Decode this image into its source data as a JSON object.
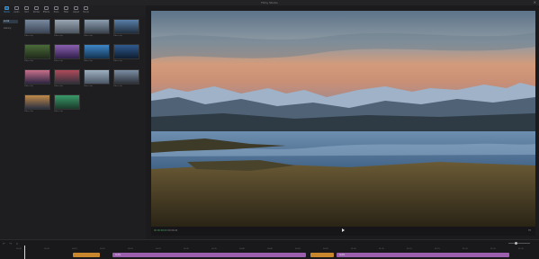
{
  "window": {
    "title": "Filmy Studio",
    "close": "✕"
  },
  "toolbar": {
    "tools": [
      {
        "label": "Media",
        "icon": "media-icon"
      },
      {
        "label": "Audio",
        "icon": "audio-icon"
      },
      {
        "label": "Text",
        "icon": "text-icon"
      },
      {
        "label": "Sticker",
        "icon": "sticker-icon"
      },
      {
        "label": "Effects",
        "icon": "effects-icon"
      },
      {
        "label": "Trans",
        "icon": "transitions-icon"
      },
      {
        "label": "Filter",
        "icon": "filter-icon"
      },
      {
        "label": "Adjust",
        "icon": "adjust-icon"
      },
      {
        "label": "Templ",
        "icon": "templates-icon"
      }
    ]
  },
  "sidebar": {
    "items": [
      {
        "label": "Local"
      },
      {
        "label": "Library"
      }
    ]
  },
  "library": {
    "header": "Import",
    "thumbs": [
      {
        "caption": "Video clip",
        "colors": [
          "#7a8aa0",
          "#3a4454"
        ]
      },
      {
        "caption": "Video clip",
        "colors": [
          "#9aa6b4",
          "#4b5560"
        ]
      },
      {
        "caption": "Video clip",
        "colors": [
          "#8c9eb0",
          "#39424c"
        ]
      },
      {
        "caption": "Video clip",
        "colors": [
          "#5a7fa8",
          "#1f2d3d"
        ]
      },
      {
        "caption": "Video clip",
        "colors": [
          "#4b6b3a",
          "#1e2a1a"
        ]
      },
      {
        "caption": "Video clip",
        "colors": [
          "#8a5fb0",
          "#30204a"
        ]
      },
      {
        "caption": "Video clip",
        "colors": [
          "#3e86c7",
          "#13324f"
        ]
      },
      {
        "caption": "Video clip",
        "colors": [
          "#2f5a8f",
          "#0f1d30"
        ]
      },
      {
        "caption": "Video clip",
        "colors": [
          "#c7708a",
          "#2a2440"
        ]
      },
      {
        "caption": "Video clip",
        "colors": [
          "#b04a5a",
          "#30303a"
        ]
      },
      {
        "caption": "Video clip",
        "colors": [
          "#9fb0c0",
          "#4a5666"
        ]
      },
      {
        "caption": "Video clip",
        "colors": [
          "#7c8ea4",
          "#2c3038"
        ]
      },
      {
        "caption": "Video clip",
        "colors": [
          "#c08a4a",
          "#2a3040"
        ]
      },
      {
        "caption": "Video clip",
        "colors": [
          "#3a9a6a",
          "#1a3a2a"
        ]
      }
    ]
  },
  "player": {
    "timecode_current": "00:00:00:00",
    "timecode_total": "00:00:26",
    "fit_label": "Fit"
  },
  "timeline": {
    "controls": "↶ ↷ ✂",
    "ticks": [
      "00:00",
      "00:05",
      "00:10",
      "00:15",
      "00:20",
      "00:25",
      "00:30",
      "00:35",
      "00:40",
      "00:45",
      "00:50",
      "00:55",
      "01:00",
      "01:05",
      "01:10",
      "01:15",
      "01:20",
      "01:25",
      "01:30"
    ],
    "clips": [
      {
        "label": "",
        "color": "#c8872c",
        "kind": "audio"
      },
      {
        "label": "Audio",
        "color": "#9b5fae",
        "kind": "music"
      },
      {
        "label": "",
        "color": "#c8872c",
        "kind": "audio"
      },
      {
        "label": "Audio",
        "color": "#9b5fae",
        "kind": "music"
      }
    ]
  }
}
